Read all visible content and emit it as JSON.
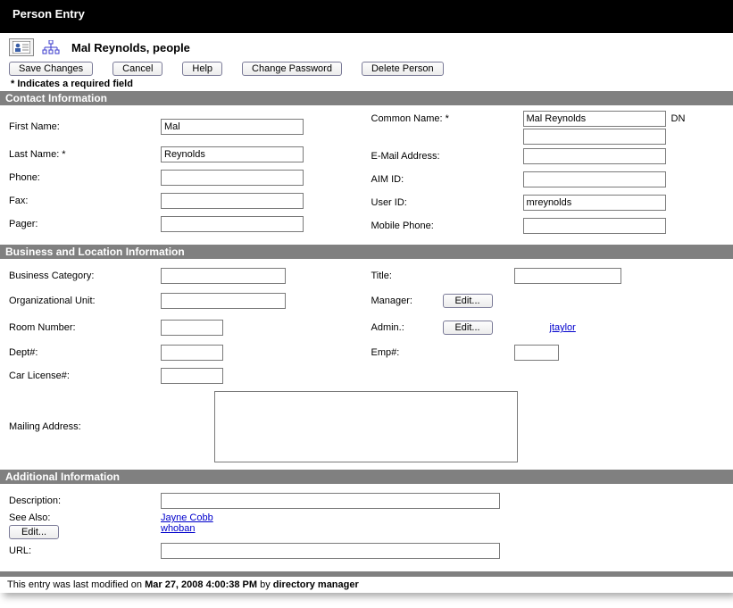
{
  "window_title": "Person Entry",
  "breadcrumb": "Mal Reynolds, people",
  "toolbar": {
    "save": "Save Changes",
    "cancel": "Cancel",
    "help": "Help",
    "change_password": "Change Password",
    "delete_person": "Delete Person"
  },
  "required_note": "* Indicates a required field",
  "sections": {
    "contact": {
      "title": "Contact Information",
      "labels": {
        "first_name": "First Name:",
        "last_name": "Last Name: *",
        "phone": "Phone:",
        "fax": "Fax:",
        "pager": "Pager:",
        "common_name": "Common Name: *",
        "email": "E-Mail Address:",
        "aim": "AIM ID:",
        "user_id": "User ID:",
        "mobile": "Mobile Phone:",
        "dn": "DN"
      },
      "values": {
        "first_name": "Mal",
        "last_name": "Reynolds",
        "phone": "",
        "fax": "",
        "pager": "",
        "common_name": "Mal Reynolds",
        "dn": "",
        "email": "",
        "aim": "",
        "user_id": "mreynolds",
        "mobile": ""
      }
    },
    "business": {
      "title": "Business and Location Information",
      "labels": {
        "category": "Business Category:",
        "ou": "Organizational Unit:",
        "room": "Room Number:",
        "dept": "Dept#:",
        "car": "Car License#:",
        "mailing": "Mailing Address:",
        "title": "Title:",
        "manager": "Manager:",
        "admin": "Admin.:",
        "emp": "Emp#:",
        "edit": "Edit..."
      },
      "values": {
        "category": "",
        "ou": "",
        "room": "",
        "dept": "",
        "car": "",
        "mailing": "",
        "title": "",
        "emp": "",
        "admin_link": "jtaylor"
      }
    },
    "additional": {
      "title": "Additional Information",
      "labels": {
        "description": "Description:",
        "see_also": "See Also:",
        "url": "URL:",
        "edit": "Edit..."
      },
      "values": {
        "description": "",
        "url": "",
        "see_also": [
          "Jayne Cobb",
          "whoban"
        ]
      }
    }
  },
  "footer": {
    "prefix": "This entry was last modified on ",
    "datetime": "Mar 27, 2008 4:00:38 PM",
    "mid": " by ",
    "actor": "directory manager"
  }
}
